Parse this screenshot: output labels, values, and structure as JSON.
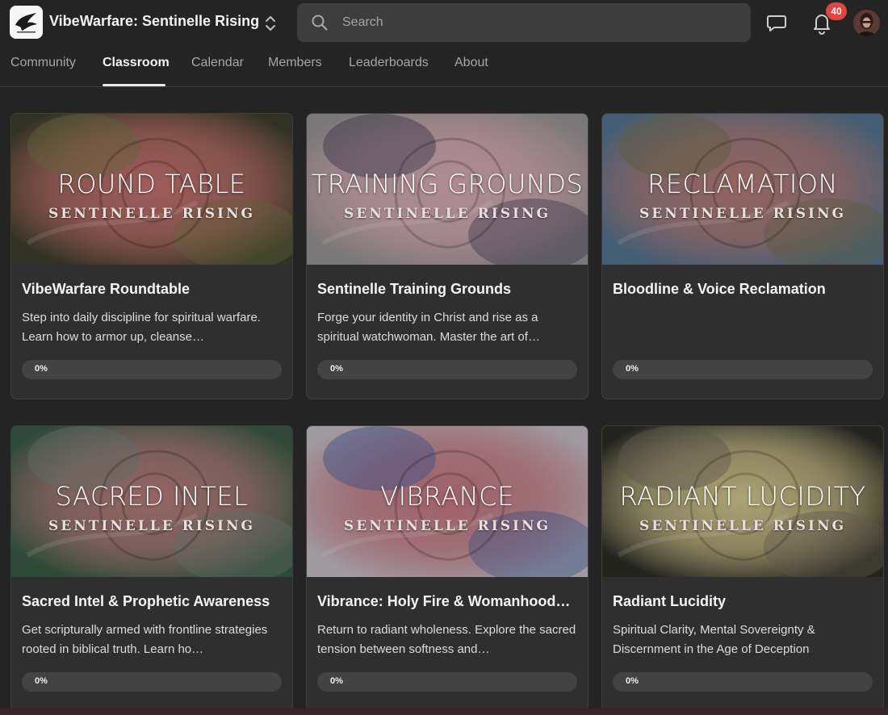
{
  "header": {
    "group_title": "VibeWarfare: Sentinelle Rising",
    "search_placeholder": "Search",
    "notification_count": "40"
  },
  "tabs": [
    {
      "label": "Community",
      "active": false
    },
    {
      "label": "Classroom",
      "active": true
    },
    {
      "label": "Calendar",
      "active": false
    },
    {
      "label": "Members",
      "active": false
    },
    {
      "label": "Leaderboards",
      "active": false
    },
    {
      "label": "About",
      "active": false
    }
  ],
  "courses": [
    {
      "cover_title": "ROUND TABLE",
      "cover_subtitle": "SENTINELLE RISING",
      "title": "VibeWarfare Roundtable",
      "description": "Step into daily discipline for spiritual warfare. Learn how to armor up, cleanse…",
      "progress_label": "0%",
      "progress": 0,
      "palette": [
        "#3a3a2a",
        "#b86b68",
        "#6f7043"
      ]
    },
    {
      "cover_title": "TRAINING GROUNDS",
      "cover_subtitle": "SENTINELLE RISING",
      "title": "Sentinelle Training Grounds",
      "description": "Forge your identity in Christ and rise as a spiritual watchwoman. Master the art of…",
      "progress_label": "0%",
      "progress": 0,
      "palette": [
        "#8a8888",
        "#c9a0a8",
        "#3b3a52"
      ]
    },
    {
      "cover_title": "RECLAMATION",
      "cover_subtitle": "SENTINELLE RISING",
      "title": "Bloodline & Voice Reclamation",
      "description": "",
      "progress_label": "0%",
      "progress": 0,
      "palette": [
        "#4d6b84",
        "#a8736e",
        "#6a6a48"
      ]
    },
    {
      "cover_title": "SACRED INTEL",
      "cover_subtitle": "SENTINELLE RISING",
      "title": "Sacred Intel & Prophetic Awareness",
      "description": "Get scripturally armed with frontline strategies rooted in biblical truth. Learn ho…",
      "progress_label": "0%",
      "progress": 0,
      "palette": [
        "#355440",
        "#a97574",
        "#6e7b76"
      ]
    },
    {
      "cover_title": "VIBRANCE",
      "cover_subtitle": "SENTINELLE RISING",
      "title": "Vibrance: Holy Fire & Womanhood…",
      "description": "Return to radiant wholeness. Explore the sacred tension between softness and…",
      "progress_label": "0%",
      "progress": 0,
      "palette": [
        "#b8b0b8",
        "#b56f78",
        "#3d5c98"
      ]
    },
    {
      "cover_title": "RADIANT LUCIDITY",
      "cover_subtitle": "SENTINELLE RISING",
      "title": "Radiant Lucidity",
      "description": "Spiritual Clarity, Mental Sovereignty & Discernment in the Age of Deception",
      "progress_label": "0%",
      "progress": 0,
      "palette": [
        "#2a2a24",
        "#c5bb86",
        "#6b6358"
      ]
    }
  ],
  "colors": {
    "background": "#242424",
    "card": "#2f2f2f",
    "badge": "#e0443e",
    "progress_track": "#434343"
  },
  "icons": [
    "logo-icon",
    "switch-group-icon",
    "search-icon",
    "chat-icon",
    "bell-icon"
  ]
}
